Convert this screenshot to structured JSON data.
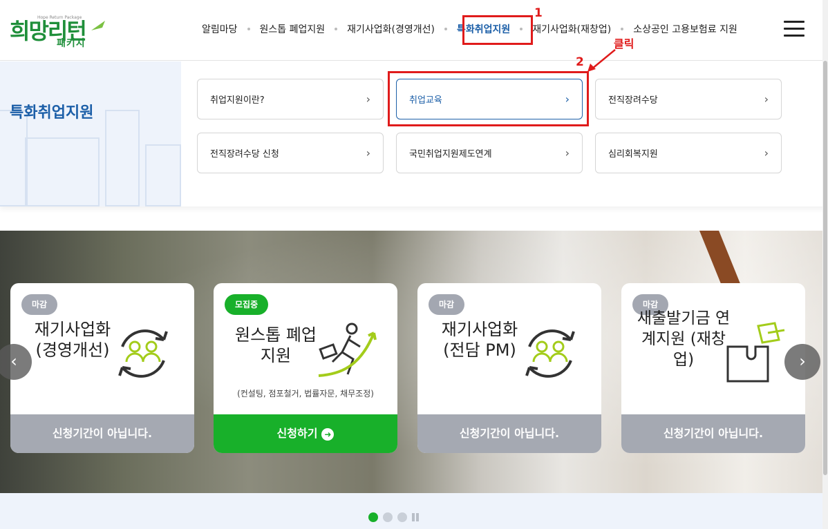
{
  "logo": {
    "main": "희망리턴",
    "sub": "패키지",
    "tagline": "Hope Return Package"
  },
  "nav": {
    "items": [
      {
        "label": "알림마당"
      },
      {
        "label": "원스톱 폐업지원"
      },
      {
        "label": "재기사업화(경영개선)"
      },
      {
        "label": "특화취업지원",
        "active": true
      },
      {
        "label": "재기사업화(재창업)"
      },
      {
        "label": "소상공인 고용보험료 지원"
      }
    ],
    "menu_icon": "hamburger-icon"
  },
  "annotations": {
    "step1": "1",
    "step2": "2",
    "click_label": "클릭",
    "color": "#e01b1b"
  },
  "submenu": {
    "title": "특화취업지원",
    "items": [
      {
        "label": "취업지원이란?"
      },
      {
        "label": "취업교육",
        "active": true
      },
      {
        "label": "전직장려수당"
      },
      {
        "label": "전직장려수당 신청"
      },
      {
        "label": "국민취업지원제도연계"
      },
      {
        "label": "심리회복지원"
      }
    ]
  },
  "cards": [
    {
      "badge": "마감",
      "title": "재기사업화(경영개선)",
      "footer": "신청기간이 아닙니다.",
      "icon": "people-cycle-icon",
      "open": false
    },
    {
      "badge": "모집중",
      "title": "원스톱 폐업지원",
      "desc": "(컨설팅, 점포철거, 법률자문, 채무조정)",
      "footer": "신청하기",
      "icon": "running-businessman-icon",
      "open": true
    },
    {
      "badge": "마감",
      "title": "재기사업화(전담 PM)",
      "footer": "신청기간이 아닙니다.",
      "icon": "people-cycle-icon",
      "open": false
    },
    {
      "badge": "마감",
      "title": "새출발기금 연계지원 (재창업)",
      "footer": "신청기간이 아닙니다.",
      "icon": "puzzle-icon",
      "open": false
    }
  ],
  "slider_controls": {
    "prev": "‹",
    "next": "›"
  },
  "colors": {
    "brand_green": "#18b02a",
    "brand_blue": "#1c5fa8",
    "closed_gray": "#a5a9b2"
  }
}
